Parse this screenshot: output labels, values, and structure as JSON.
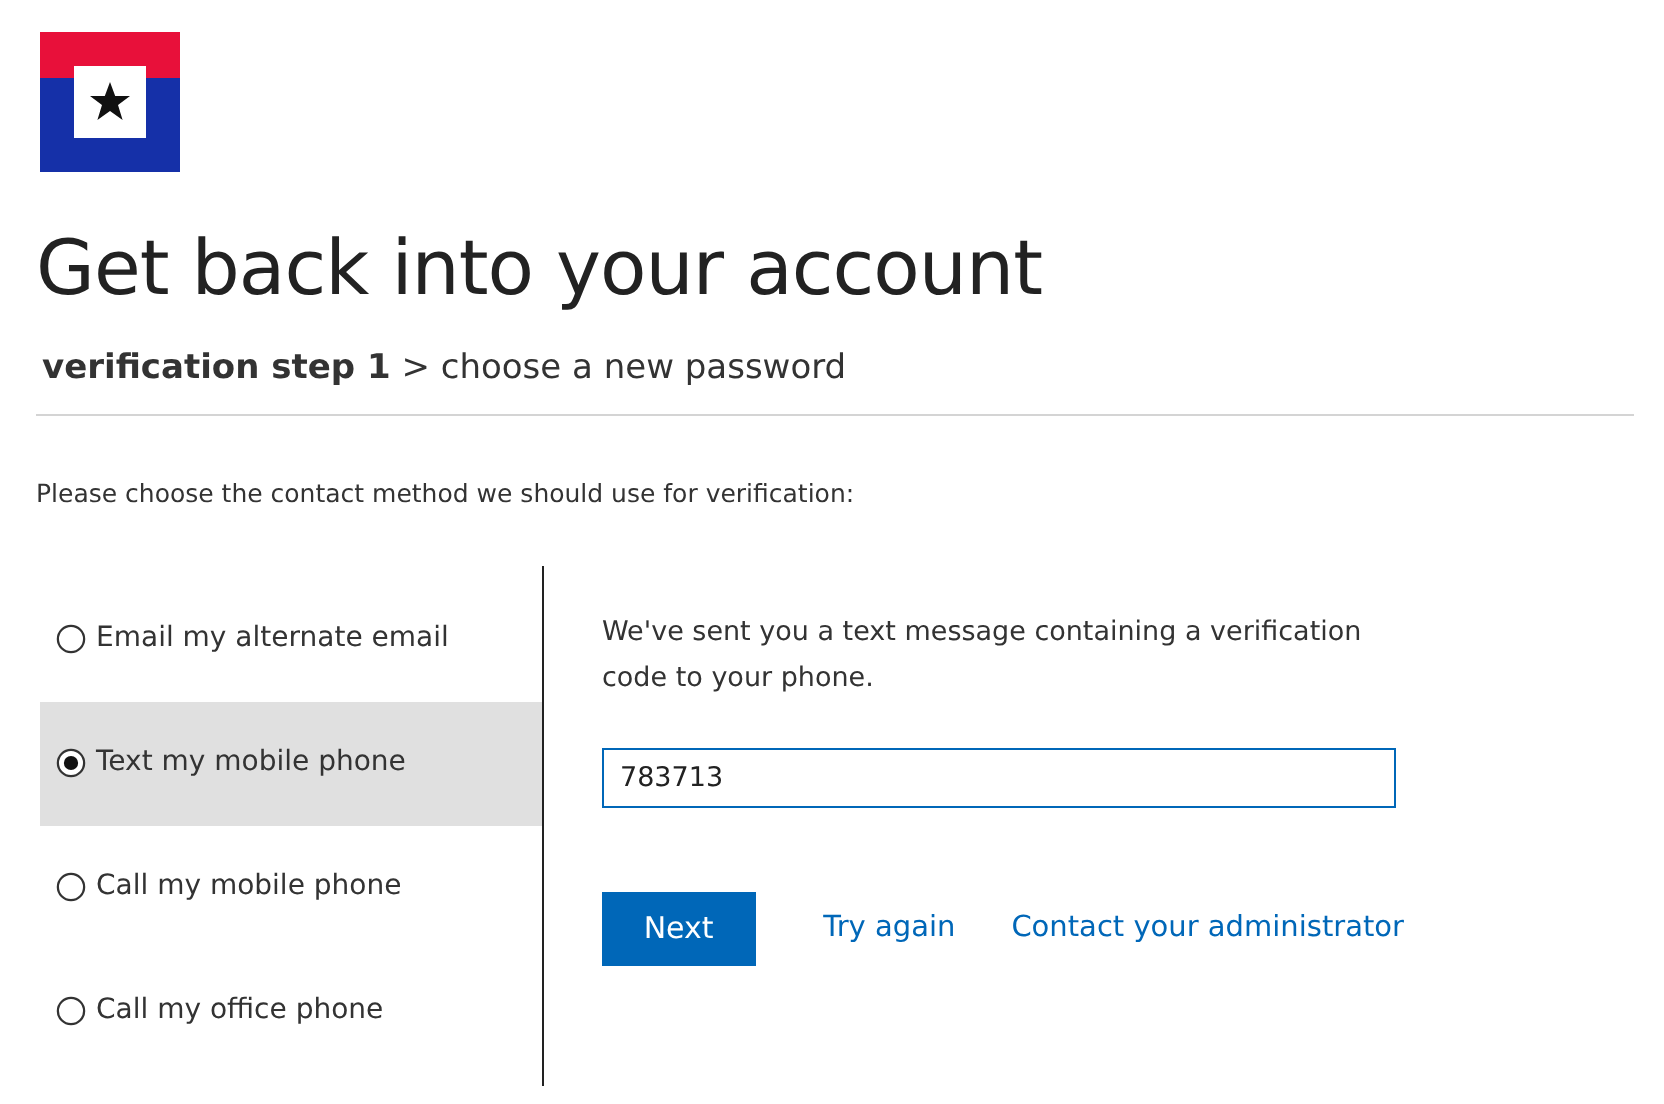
{
  "title": "Get back into your account",
  "breadcrumb": "**verification step 1** > choose a new password",
  "instruction": "Please choose the contact method we should use for verification:",
  "methods": [
    {
      "label": "Email my alternate email",
      "selected": false
    },
    {
      "label": "Text my mobile phone",
      "selected": true
    },
    {
      "label": "Call my mobile phone",
      "selected": false
    },
    {
      "label": "Call my office phone",
      "selected": false
    }
  ],
  "message": "We've sent you a text message containing a verification code to your phone.",
  "code_field": {
    "value": "783713"
  },
  "buttons": {
    "primary": "Next",
    "links": [
      "Try again",
      "Contact your administrator"
    ]
  }
}
